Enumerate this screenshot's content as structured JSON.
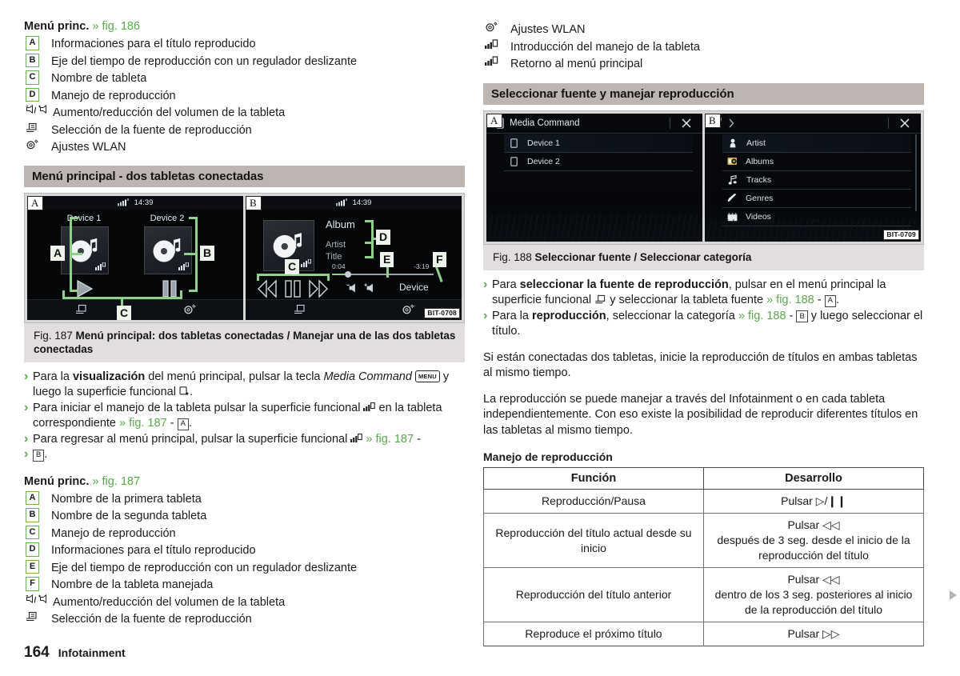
{
  "left_column": {
    "legend_186": {
      "lead": "Menú princ.",
      "figref": "» fig. 186",
      "items": [
        {
          "key": "A",
          "icon": "",
          "text": "Informaciones para el título reproducido"
        },
        {
          "key": "B",
          "icon": "",
          "text": "Eje del tiempo de reproducción con un regulador deslizante"
        },
        {
          "key": "C",
          "icon": "",
          "text": "Nombre de tableta"
        },
        {
          "key": "D",
          "icon": "",
          "text": "Manejo de reproducción"
        },
        {
          "key": "",
          "icon": "volume-down-up-icon",
          "text": "Aumento/reducción del volumen de la tableta"
        },
        {
          "key": "",
          "icon": "source-select-icon",
          "text": "Selección de la fuente de reproducción"
        },
        {
          "key": "",
          "icon": "wlan-settings-icon",
          "text": "Ajustes WLAN"
        }
      ]
    },
    "section_header": "Menú principal - dos tabletas conectadas",
    "figure_187": {
      "bit_code": "BIT-0708",
      "screen_a": {
        "corner_letter": "A",
        "clock": "14:39",
        "device1": "Device 1",
        "device2": "Device 2",
        "markers": [
          "A",
          "B",
          "C"
        ]
      },
      "screen_b": {
        "corner_letter": "B",
        "clock": "14:39",
        "album": "Album",
        "artist": "Artist",
        "title": "Title",
        "time_elapsed": "0:04",
        "time_remaining": "-3:19",
        "device": "Device",
        "markers": [
          "C",
          "D",
          "E",
          "F"
        ]
      },
      "caption_no": "Fig. 187",
      "caption_text": "Menú principal: dos tabletas conectadas / Manejar una de las dos tabletas conectadas"
    },
    "bullets_187": [
      "Para la visualización del menú principal, pulsar la tecla Media Command MENU y luego la superficie funcional .",
      "Para iniciar el manejo de la tableta pulsar la superficie funcional en la tableta correspondiente » fig. 187 - A.",
      "Para regresar al menú principal, pulsar la superficie funcional » fig. 187 - B."
    ],
    "legend_187": {
      "lead": "Menú princ.",
      "figref": "» fig. 187",
      "items": [
        {
          "key": "A",
          "icon": "",
          "text": "Nombre de la primera tableta"
        },
        {
          "key": "B",
          "icon": "",
          "text": "Nombre de la segunda tableta"
        },
        {
          "key": "C",
          "icon": "",
          "text": "Manejo de reproducción"
        },
        {
          "key": "D",
          "icon": "",
          "text": "Informaciones para el título reproducido"
        },
        {
          "key": "E",
          "icon": "",
          "text": "Eje del tiempo de reproducción con un regulador deslizante"
        },
        {
          "key": "F",
          "icon": "",
          "text": "Nombre de la tableta manejada"
        },
        {
          "key": "",
          "icon": "volume-down-up-icon",
          "text": "Aumento/reducción del volumen de la tableta"
        },
        {
          "key": "",
          "icon": "source-select-icon",
          "text": "Selección de la fuente de reproducción"
        }
      ]
    }
  },
  "right_column": {
    "legend_top": [
      {
        "icon": "wlan-settings-icon",
        "text": "Ajustes WLAN"
      },
      {
        "icon": "tablet-control-start-icon",
        "text": "Introducción del manejo de la tableta"
      },
      {
        "icon": "tablet-control-return-icon",
        "text": "Retorno al menú principal"
      }
    ],
    "section_header": "Seleccionar fuente y manejar reproducción",
    "figure_188": {
      "bit_code": "BIT-0709",
      "screen_a": {
        "corner_letter": "A",
        "title": "Media Command",
        "items": [
          {
            "icon": "tablet-icon",
            "label": "Device 1"
          },
          {
            "icon": "tablet-icon",
            "label": "Device 2"
          }
        ]
      },
      "screen_b": {
        "corner_letter": "B",
        "title": "",
        "items": [
          {
            "icon": "artist-icon",
            "label": "Artist"
          },
          {
            "icon": "albums-icon",
            "label": "Albums"
          },
          {
            "icon": "tracks-icon",
            "label": "Tracks"
          },
          {
            "icon": "genres-icon",
            "label": "Genres"
          },
          {
            "icon": "videos-icon",
            "label": "Videos"
          }
        ]
      },
      "caption_no": "Fig. 188",
      "caption_text": "Seleccionar fuente / Seleccionar categoría"
    },
    "body": {
      "bullet1_a": "Para ",
      "bullet1_b": "seleccionar la fuente de reproducción",
      "bullet1_c": ", pulsar en el menú principal la superficie funcional ",
      "bullet1_d": " y seleccionar la tableta fuente ",
      "bullet1_ref": "» fig. 188",
      "bullet1_key": "A",
      "bullet2_a": "Para la ",
      "bullet2_b": "reproducción",
      "bullet2_c": ", seleccionar la categoría ",
      "bullet2_ref": "» fig. 188",
      "bullet2_key": "B",
      "bullet2_d": " y luego seleccionar el título.",
      "para1": "Si están conectadas dos tabletas, inicie la reproducción de títulos en ambas tabletas al mismo tiempo.",
      "para2": "La reproducción se puede manejar a través del Infotainment o en cada tableta independientemente. Con eso existe la posibilidad de reproducir diferentes títulos en las tabletas al mismo tiempo.",
      "subheading": "Manejo de reproducción"
    },
    "table": {
      "headers": [
        "Función",
        "Desarrollo"
      ],
      "rows": [
        {
          "funcion": "Reproducción/Pausa",
          "desarrollo": "Pulsar ▷/❙❙"
        },
        {
          "funcion": "Reproducción del título actual desde su inicio",
          "desarrollo": "Pulsar ◁◁\ndespués de 3 seg. desde el inicio de la reproducción del título"
        },
        {
          "funcion": "Reproducción del título anterior",
          "desarrollo": "Pulsar ◁◁\ndentro de los 3 seg. posteriores al inicio de la reproducción del título"
        },
        {
          "funcion": "Reproduce el próximo título",
          "desarrollo": "Pulsar ▷▷"
        }
      ]
    }
  },
  "footer": {
    "page_number": "164",
    "section": "Infotainment"
  },
  "colors": {
    "accent_green": "#5aa84c",
    "key_border_green": "#6ab04c",
    "section_bar": "#bdb5b2",
    "caption_bar": "#e2dedd",
    "screen_bg": "#050608",
    "marker_bg": "#eef3ec",
    "marker_green": "#8fd08a"
  }
}
